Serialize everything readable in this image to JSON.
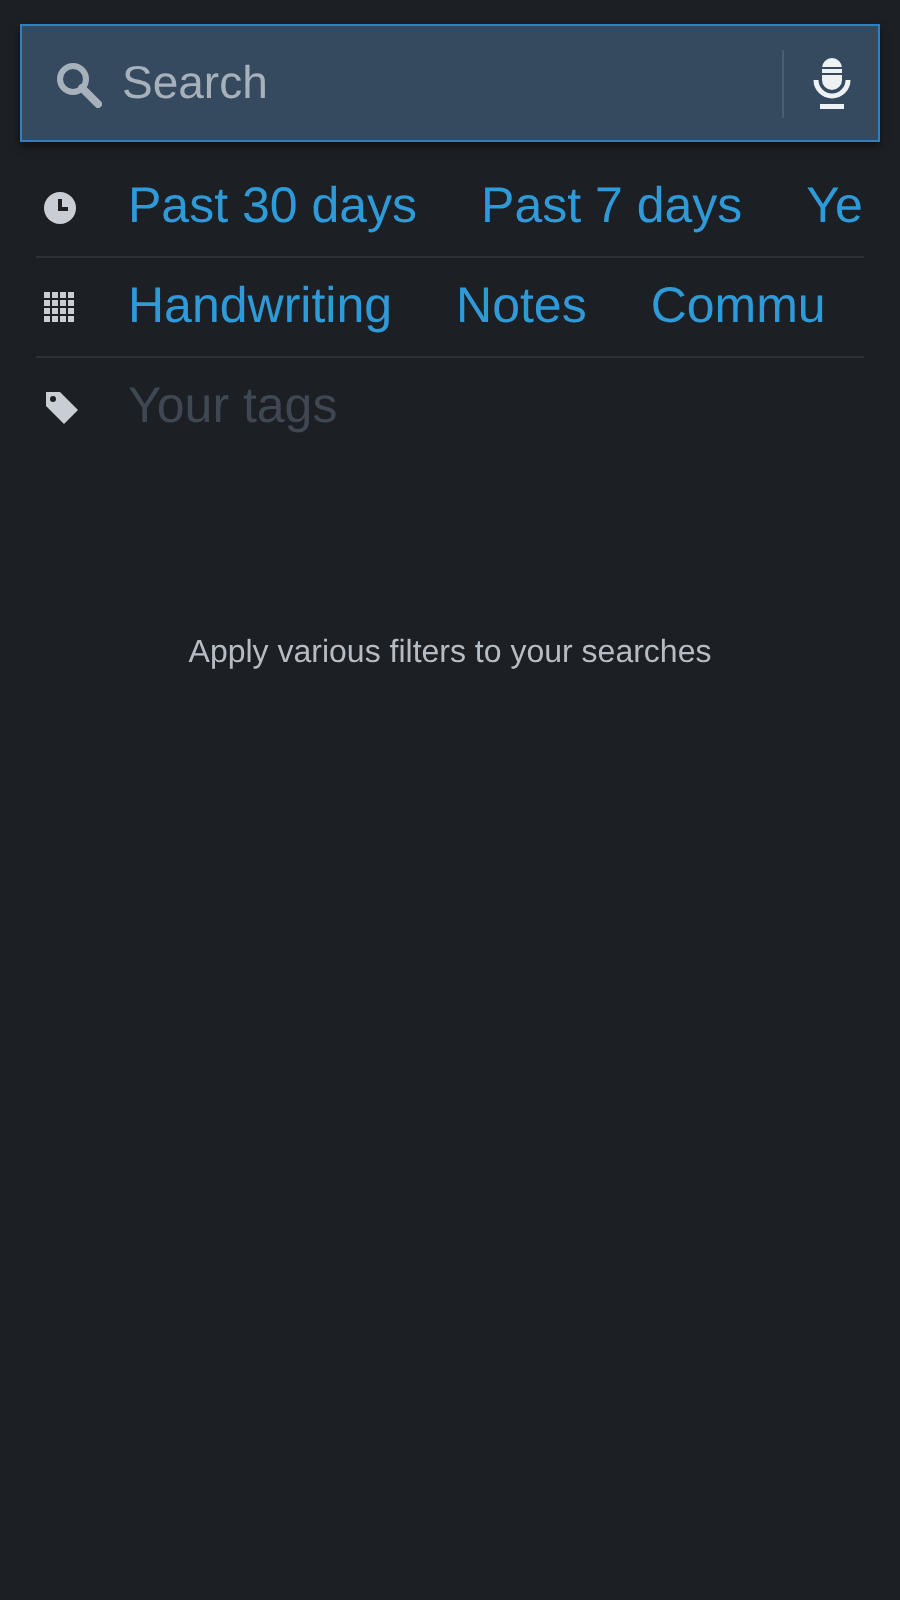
{
  "search": {
    "placeholder": "Search"
  },
  "filter_rows": [
    {
      "kind": "time",
      "options": [
        "Past 30 days",
        "Past 7 days",
        "Ye"
      ]
    },
    {
      "kind": "type",
      "options": [
        "Handwriting",
        "Notes",
        "Commu"
      ]
    },
    {
      "kind": "tags",
      "placeholder": "Your tags"
    }
  ],
  "hint": "Apply various filters to your searches"
}
